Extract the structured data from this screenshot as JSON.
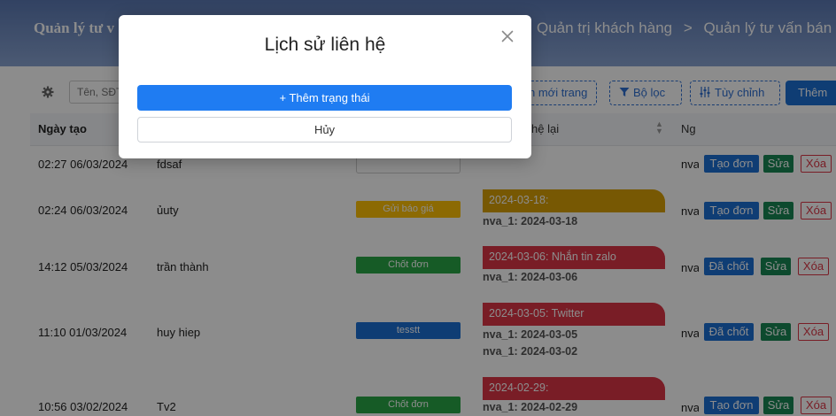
{
  "header": {
    "title": "Quản lý tư v",
    "breadcrumb": [
      "Quản trị khách hàng",
      "Quản lý tư vấn bán hàng"
    ],
    "separator": ">"
  },
  "toolbar": {
    "search_placeholder": "Tên, SĐT",
    "open_new_tab_label": "n mới trang",
    "filter_label": "Bộ lọc",
    "customize_label": "Tùy chỉnh",
    "add_label": "Thêm"
  },
  "table": {
    "headers": {
      "created": "Ngày tạo",
      "recontact": "hệ lại",
      "ng": "Ng"
    },
    "rows": [
      {
        "date": "02:27 06/03/2024",
        "name": "fdsaf",
        "status": "",
        "status_color": "#ffffff",
        "note_head": "",
        "note_color": "",
        "notes": [],
        "creator": "nva",
        "action": "Tạo đơn",
        "edit": "Sửa",
        "delete": "Xóa"
      },
      {
        "date": "02:24 06/03/2024",
        "name": "ủuty",
        "status": "Gửi báo giá",
        "status_color": "#ffc107",
        "note_head": "2024-03-18:",
        "note_color": "#d9a106",
        "notes": [
          "nva_1: 2024-03-18"
        ],
        "creator": "nva",
        "action": "Tạo đơn",
        "edit": "Sửa",
        "delete": "Xóa"
      },
      {
        "date": "14:12 05/03/2024",
        "name": "trần thành",
        "status": "Chốt đơn",
        "status_color": "#28a745",
        "note_head": "2024-03-06: Nhắn tin zalo",
        "note_color": "#dc3545",
        "notes": [
          "nva_1: 2024-03-06"
        ],
        "creator": "nva",
        "action": "Đã chốt",
        "edit": "Sửa",
        "delete": "Xóa"
      },
      {
        "date": "11:10 01/03/2024",
        "name": "huy hiep",
        "status": "tesstt",
        "status_color": "#1c6fd4",
        "note_head": "2024-03-05: Twitter",
        "note_color": "#dc3545",
        "notes": [
          "nva_1: 2024-03-05",
          "nva_1: 2024-03-02"
        ],
        "creator": "nva",
        "action": "Đã chốt",
        "edit": "Sửa",
        "delete": "Xóa"
      },
      {
        "date": "10:56 03/02/2024",
        "name": "Tv2",
        "status": "Chốt đơn",
        "status_color": "#28a745",
        "note_head": "2024-02-29:",
        "note_color": "#dc3545",
        "notes": [
          "nva_1: 2024-02-29"
        ],
        "creator": "nva",
        "action": "Tạo đơn",
        "edit": "Sửa",
        "delete": "Xóa"
      }
    ]
  },
  "modal": {
    "title": "Lịch sử liên hệ",
    "add_status_label": "+ Thêm trạng thái",
    "cancel_label": "Hủy",
    "close_icon": "close-icon"
  }
}
